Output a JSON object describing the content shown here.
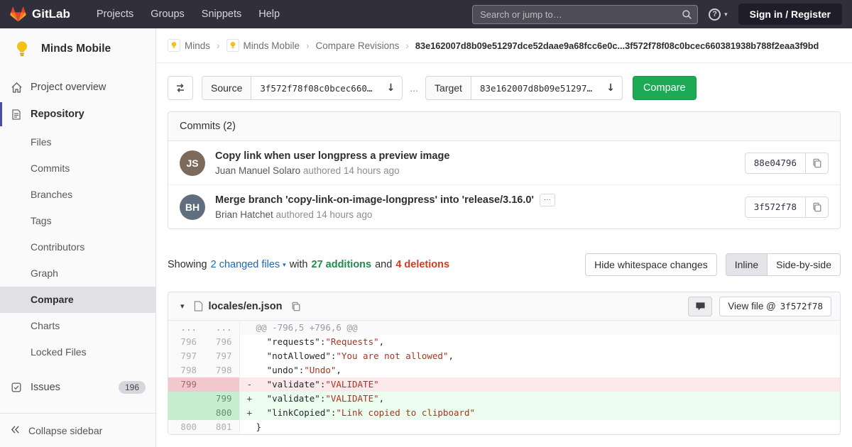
{
  "navbar": {
    "brand": "GitLab",
    "menu": [
      "Projects",
      "Groups",
      "Snippets",
      "Help"
    ],
    "search_placeholder": "Search or jump to…",
    "help_glyph": "?",
    "sign_in": "Sign in / Register"
  },
  "sidebar": {
    "project": {
      "name": "Minds Mobile"
    },
    "overview_label": "Project overview",
    "repository_label": "Repository",
    "repository_items": [
      "Files",
      "Commits",
      "Branches",
      "Tags",
      "Contributors",
      "Graph",
      "Compare",
      "Charts",
      "Locked Files"
    ],
    "active_item": "Compare",
    "issues_label": "Issues",
    "issues_count": "196",
    "collapse_label": "Collapse sidebar"
  },
  "breadcrumb": {
    "items": [
      "Minds",
      "Minds Mobile",
      "Compare Revisions"
    ],
    "separator": "›",
    "current": "83e162007d8b09e51297dce52daae9a68fcc6e0c...3f572f78f08c0bcec660381938b788f2eaa3f9bd"
  },
  "compare_form": {
    "source_label": "Source",
    "source_value": "3f572f78f08c0bcec660…",
    "ellipsis": "...",
    "target_label": "Target",
    "target_value": "83e162007d8b09e51297…",
    "compare_button": "Compare"
  },
  "commits": {
    "header": "Commits (2)",
    "items": [
      {
        "title": "Copy link when user longpress a preview image",
        "author": "Juan Manuel Solaro",
        "meta": "authored 14 hours ago",
        "sha": "88e04796",
        "initials": "JS",
        "expandable": false
      },
      {
        "title": "Merge branch 'copy-link-on-image-longpress' into 'release/3.16.0'",
        "author": "Brian Hatchet",
        "meta": "authored 14 hours ago",
        "sha": "3f572f78",
        "initials": "BH",
        "expandable": true
      }
    ]
  },
  "diff_summary": {
    "showing": "Showing",
    "changed_files": "2 changed files",
    "with_word": "with",
    "additions": "27 additions",
    "and_word": "and",
    "deletions": "4 deletions",
    "hide_whitespace": "Hide whitespace changes",
    "inline": "Inline",
    "side_by_side": "Side-by-side"
  },
  "file_diff": {
    "filename": "locales/en.json",
    "view_file": "View file @",
    "view_file_sha": "3f572f78",
    "lines": [
      {
        "type": "hunk",
        "old": "...",
        "new": "...",
        "sign": "",
        "segments": [
          {
            "t": "@@ -796,5 +796,6 @@",
            "c": "hunk"
          }
        ]
      },
      {
        "type": "context",
        "old": "796",
        "new": "796",
        "sign": "",
        "segments": [
          {
            "t": "  ",
            "c": "p"
          },
          {
            "t": "\"requests\"",
            "c": "k"
          },
          {
            "t": ":",
            "c": "p"
          },
          {
            "t": "\"Requests\"",
            "c": "s"
          },
          {
            "t": ",",
            "c": "p"
          }
        ]
      },
      {
        "type": "context",
        "old": "797",
        "new": "797",
        "sign": "",
        "segments": [
          {
            "t": "  ",
            "c": "p"
          },
          {
            "t": "\"notAllowed\"",
            "c": "k"
          },
          {
            "t": ":",
            "c": "p"
          },
          {
            "t": "\"You are not allowed\"",
            "c": "s"
          },
          {
            "t": ",",
            "c": "p"
          }
        ]
      },
      {
        "type": "context",
        "old": "798",
        "new": "798",
        "sign": "",
        "segments": [
          {
            "t": "  ",
            "c": "p"
          },
          {
            "t": "\"undo\"",
            "c": "k"
          },
          {
            "t": ":",
            "c": "p"
          },
          {
            "t": "\"Undo\"",
            "c": "s"
          },
          {
            "t": ",",
            "c": "p"
          }
        ]
      },
      {
        "type": "removed",
        "old": "799",
        "new": "",
        "sign": "-",
        "segments": [
          {
            "t": "  ",
            "c": "p"
          },
          {
            "t": "\"validate\"",
            "c": "k"
          },
          {
            "t": ":",
            "c": "p"
          },
          {
            "t": "\"VALIDATE\"",
            "c": "s"
          }
        ]
      },
      {
        "type": "added",
        "old": "",
        "new": "799",
        "sign": "+",
        "segments": [
          {
            "t": "  ",
            "c": "p"
          },
          {
            "t": "\"validate\"",
            "c": "k"
          },
          {
            "t": ":",
            "c": "p"
          },
          {
            "t": "\"VALIDATE\"",
            "c": "s"
          },
          {
            "t": ",",
            "c": "p"
          }
        ]
      },
      {
        "type": "added",
        "old": "",
        "new": "800",
        "sign": "+",
        "segments": [
          {
            "t": "  ",
            "c": "p"
          },
          {
            "t": "\"linkCopied\"",
            "c": "k"
          },
          {
            "t": ":",
            "c": "p"
          },
          {
            "t": "\"Link copied to clipboard\"",
            "c": "s"
          }
        ]
      },
      {
        "type": "context",
        "old": "800",
        "new": "801",
        "sign": "",
        "segments": [
          {
            "t": "}",
            "c": "p"
          }
        ]
      }
    ]
  },
  "glyphs": {
    "caret_down": "▾",
    "download_arrow": "↓",
    "ellipsis_button": "···",
    "chevron_expanded": "▾"
  },
  "colors": {
    "navbar_bg": "#312f3c",
    "sidebar_bg": "#fafafa",
    "active_indicator": "#4b4ba3",
    "compare_button_green": "#1caa55",
    "link_blue": "#1b69b6",
    "additions_green": "#1f8b4d",
    "deletions_red": "#d63a21",
    "removed_line_bg": "#fbe9eb",
    "added_line_bg": "#ecfdf0",
    "code_string_red": "#b2301f"
  }
}
